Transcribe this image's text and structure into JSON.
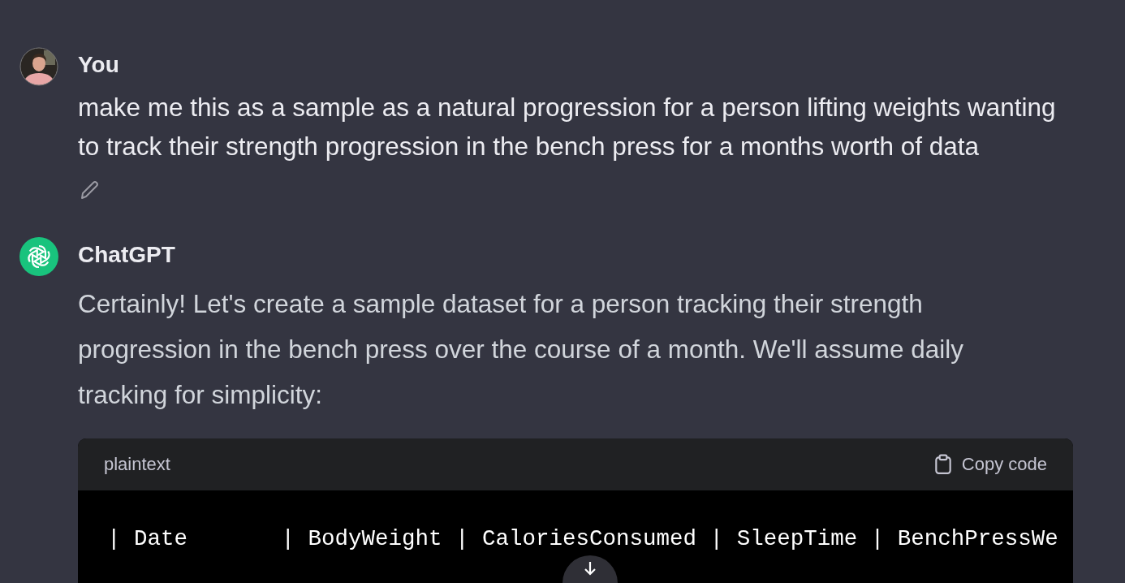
{
  "messages": [
    {
      "kind": "user",
      "author": "You",
      "text": "make me this as a sample as a natural progression for a person lifting weights wanting to track their strength progression in the bench press for a months worth of data",
      "editable": true
    },
    {
      "kind": "assistant",
      "author": "ChatGPT",
      "text": "Certainly! Let's create a sample dataset for a person tracking their strength progression in the bench press over the course of a month. We'll assume daily tracking for simplicity:",
      "code": {
        "language": "plaintext",
        "copy_label": "Copy code",
        "lines": [
          "| Date       | BodyWeight | CaloriesConsumed | SleepTime | BenchPressWe"
        ]
      }
    }
  ]
}
